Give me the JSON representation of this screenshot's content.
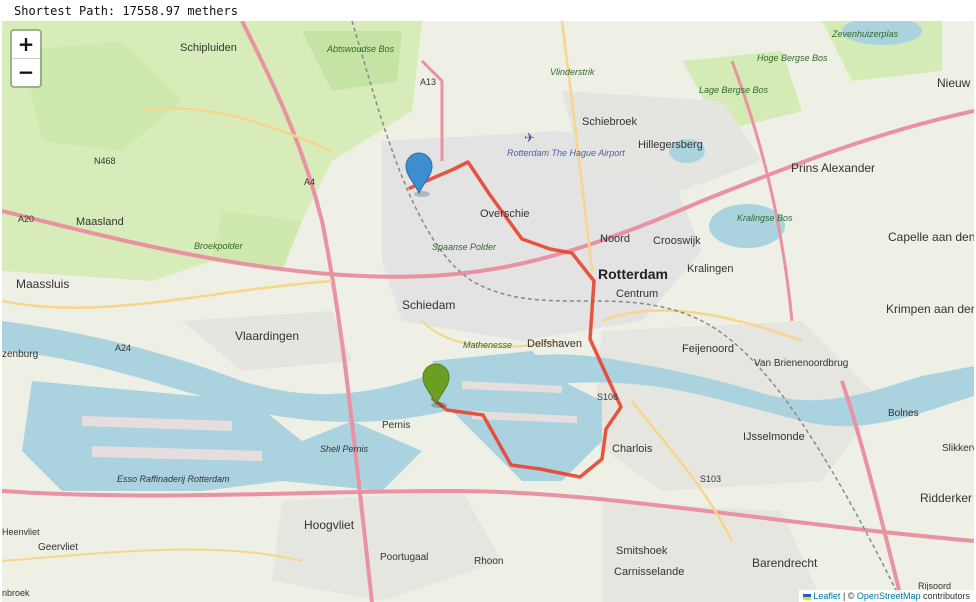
{
  "header": {
    "text": "Shortest Path: 17558.97 methers"
  },
  "zoom": {
    "in_label": "+",
    "out_label": "−"
  },
  "attribution": {
    "leaflet": "Leaflet",
    "sep": " | © ",
    "osm": "OpenStreetMap",
    "suffix": " contributors"
  },
  "colors": {
    "route": "#e8432e",
    "start_marker": "#3b8fd1",
    "end_marker": "#6a9f23",
    "water": "#aad3df",
    "land": "#eef0e6",
    "green": "#cde6b0"
  },
  "markers": {
    "start": "blue-marker",
    "end": "green-marker"
  },
  "labels": {
    "schipluiden": "Schipluiden",
    "abtswoudse": "Abtswoudse Bos",
    "a13": "A13",
    "vlinderstrik": "Vlinderstrik",
    "schiebroek": "Schiebroek",
    "hillegersberg": "Hillegersberg",
    "hoge_bergse": "Hoge Bergse Bos",
    "lage_bergse": "Lage Bergse Bos",
    "zevenhuizer": "Zevenhuizerplas",
    "nieuwe": "Nieuw aan d",
    "airport": "Rotterdam The Hague Airport",
    "n468": "N468",
    "a4": "A4",
    "prins_alexander": "Prins Alexander",
    "a20": "A20",
    "maasland": "Maasland",
    "overschie": "Overschie",
    "noord": "Noord",
    "crooswijk": "Crooswijk",
    "kralingse_bos": "Kralingse Bos",
    "capelle": "Capelle aan den IJssel",
    "broekpolder": "Broekpolder",
    "spaanse": "Spaanse Polder",
    "rotterdam": "Rotterdam",
    "kralingen": "Kralingen",
    "centrum": "Centrum",
    "maassluis": "Maassluis",
    "schiedam": "Schiedam",
    "krimpen": "Krimpen aan den IJssel",
    "vlaardingen": "Vlaardingen",
    "a24": "A24",
    "mathenesse": "Mathenesse",
    "delfshaven": "Delfshaven",
    "feijenoord": "Feijenoord",
    "van_brienenoord": "Van Brienenoordbrug",
    "rozenburg": "zenburg",
    "s106": "S106",
    "pernis": "Pernis",
    "bolnes": "Bolnes",
    "shell_pernis": "Shell Pernis",
    "charlois": "Charlois",
    "ijsselmonde": "IJsselmonde",
    "slikkerveer": "Slikkerv",
    "esso": "Esso Raffinaderij Rotterdam",
    "s103": "S103",
    "ridderkerk": "Ridderker",
    "hoogvliet": "Hoogvliet",
    "heenvliet": "Heenvliet",
    "geervliet": "Geervliet",
    "poortugaal": "Poortugaal",
    "smitshoek": "Smitshoek",
    "barendrecht": "Barendrecht",
    "rhoon": "Rhoon",
    "carnisselande": "Carnisselande",
    "nbroek": "nbroek",
    "rijsoord": "Rijsoord"
  }
}
